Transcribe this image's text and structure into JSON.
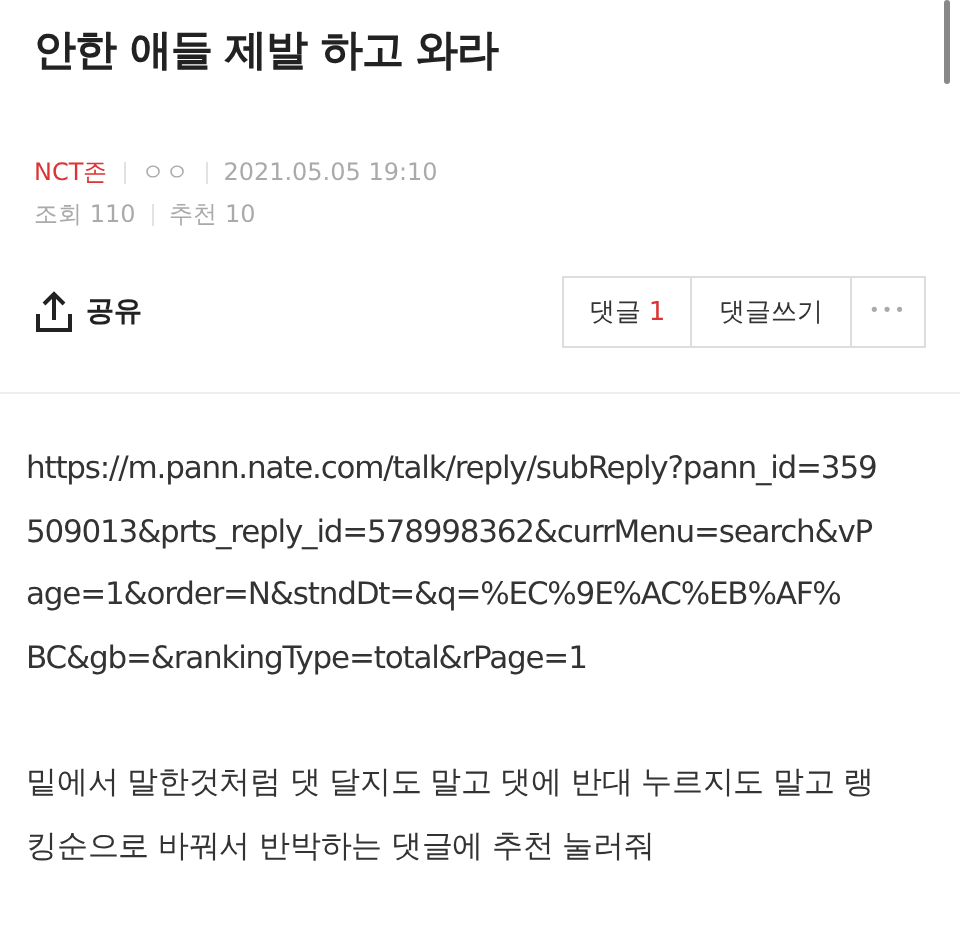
{
  "title": "안한 애들 제발 하고 와라",
  "meta": {
    "author": "NCT존",
    "nickname": "ㅇㅇ",
    "date": "2021.05.05 19:10",
    "views": "조회 110",
    "recommends": "추천 10"
  },
  "share": {
    "label": "공유"
  },
  "actions": {
    "comments_label": "댓글",
    "comments_count": "1",
    "write": "댓글쓰기",
    "more": "•••"
  },
  "body": {
    "url_lines": [
      "https://m.pann.nate.com/talk/reply/subReply?pann_id=359",
      "509013&prts_reply_id=578998362&currMenu=search&vP",
      "age=1&order=N&stndDt=&q=%EC%9E%AC%EB%AF%",
      "BC&gb=&rankingType=total&rPage=1"
    ],
    "text_lines": [
      "밑에서 말한것처럼 댓 달지도 말고 댓에 반대 누르지도 말고 랭",
      "킹순으로 바꿔서 반박하는 댓글에 추천 눌러줘"
    ]
  }
}
